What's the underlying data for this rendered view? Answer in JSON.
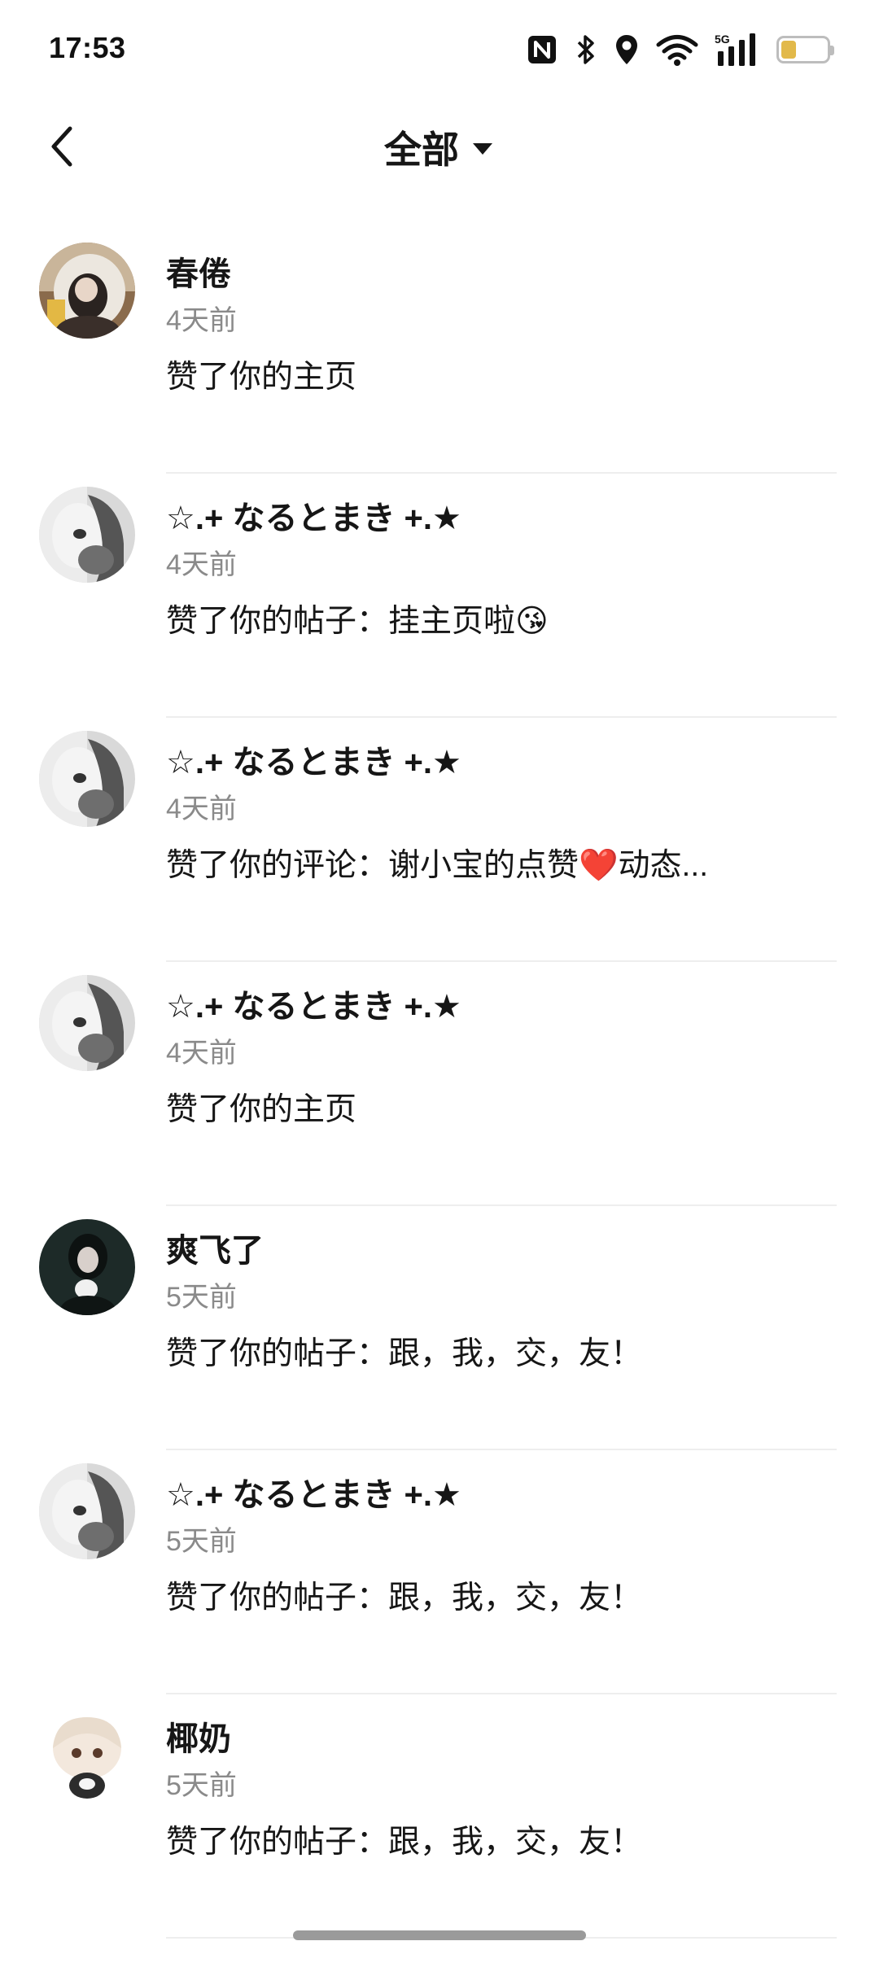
{
  "status_bar": {
    "time": "17:53",
    "battery_level": "8",
    "battery_color": "#e2b94a",
    "icons": [
      "nfc-icon",
      "bluetooth-icon",
      "location-icon",
      "wifi-icon",
      "signal-5g-icon",
      "battery-icon"
    ]
  },
  "header": {
    "back_icon": "back-arrow-icon",
    "title": "全部",
    "dropdown_icon": "caret-down-icon"
  },
  "notifications": [
    {
      "name": "春倦",
      "time": "4天前",
      "text": "赞了你的主页",
      "avatar": "avatar-photo-1"
    },
    {
      "name": "☆.+ なるとまき +.★",
      "time": "4天前",
      "text": "赞了你的帖子：挂主页啦😘",
      "avatar": "avatar-photo-2"
    },
    {
      "name": "☆.+ なるとまき +.★",
      "time": "4天前",
      "text": "赞了你的评论：谢小宝的点赞❤️动态...",
      "avatar": "avatar-photo-2"
    },
    {
      "name": "☆.+ なるとまき +.★",
      "time": "4天前",
      "text": "赞了你的主页",
      "avatar": "avatar-photo-2"
    },
    {
      "name": "爽飞了",
      "time": "5天前",
      "text": "赞了你的帖子：跟，我，交，友！",
      "avatar": "avatar-photo-3"
    },
    {
      "name": "☆.+ なるとまき +.★",
      "time": "5天前",
      "text": "赞了你的帖子：跟，我，交，友！",
      "avatar": "avatar-photo-2"
    },
    {
      "name": "椰奶",
      "time": "5天前",
      "text": "赞了你的帖子：跟，我，交，友！",
      "avatar": "avatar-illustration-4"
    }
  ]
}
